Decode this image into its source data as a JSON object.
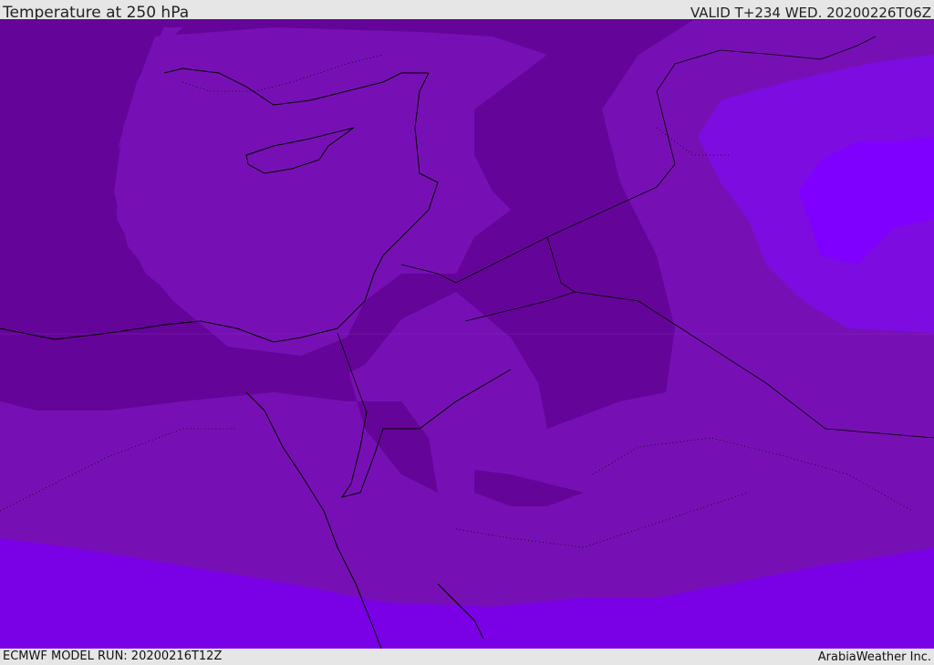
{
  "header": {
    "title": "Temperature at 250 hPa",
    "valid": "VALID T+234 WED. 20200226T06Z"
  },
  "footer": {
    "model_run": "ECMWF MODEL RUN: 20200216T12Z",
    "credit": "ArabiaWeather Inc."
  },
  "colors": {
    "band_warm": "#7710b4",
    "band_cold": "#650499",
    "band_mid": "#7c0ce0",
    "band_south": "#7a00e6",
    "band_east": "#8000ff",
    "background_bar": "#e6e6e6"
  }
}
